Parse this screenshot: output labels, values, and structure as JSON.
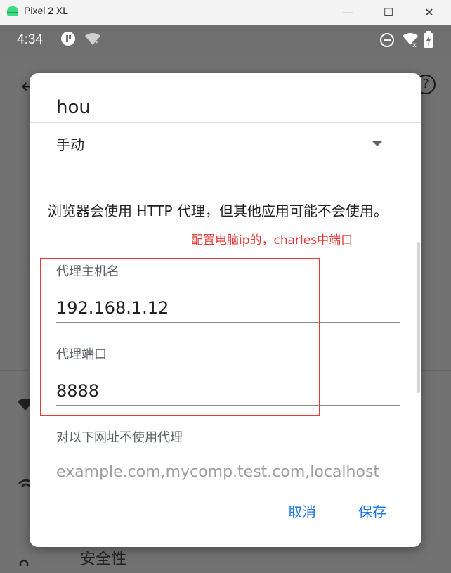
{
  "window": {
    "title": "Pixel 2 XL",
    "buttons": {
      "minimize": "—",
      "maximize": "☐",
      "close": "✕"
    }
  },
  "status_bar": {
    "time": "4:34",
    "icons": [
      "app-notification-icon",
      "wifi-unknown-icon",
      "do-not-disturb-icon",
      "wifi-off-icon",
      "battery-charging-icon"
    ]
  },
  "background": {
    "partial_label": "安全性"
  },
  "dialog": {
    "title": "hou",
    "proxy_mode": "手动",
    "notice": "浏览器会使用 HTTP 代理，但其他应用可能不会使用。",
    "host_label": "代理主机名",
    "host_value": "192.168.1.12",
    "port_label": "代理端口",
    "port_value": "8888",
    "bypass_label": "对以下网址不使用代理",
    "bypass_value": "example.com,mycomp.test.com,localhost",
    "cancel_label": "取消",
    "save_label": "保存"
  },
  "annotation": {
    "text": "配置电脑ip的，charles中端口",
    "color": "#e53935"
  },
  "colors": {
    "accent": "#1a73e8",
    "annotation": "#e53935",
    "scrim": "#727272"
  }
}
